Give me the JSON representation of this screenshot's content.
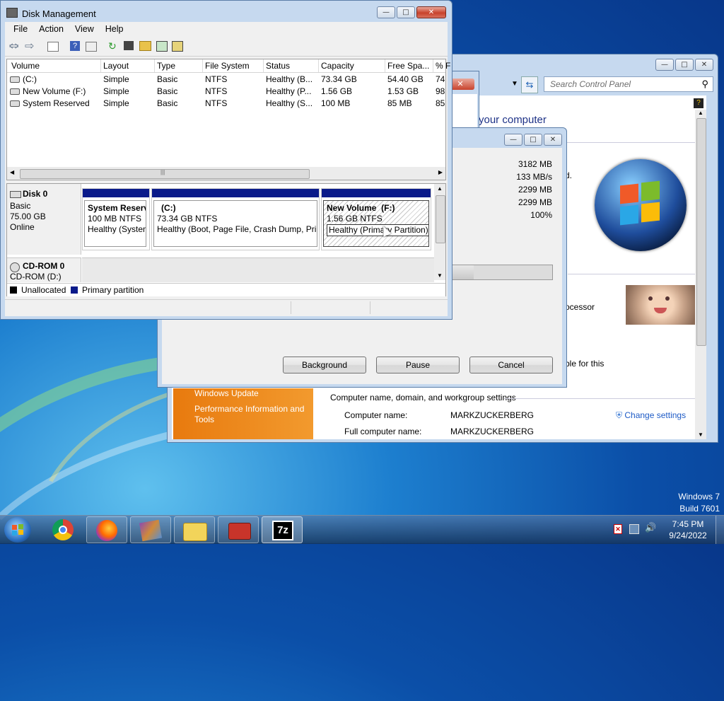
{
  "desktop": {
    "watermark": [
      "Windows 7",
      "Build 7601"
    ]
  },
  "control_panel": {
    "search_placeholder": "Search Control Panel",
    "heading_partial": "your computer",
    "processor_partial": "ocessor",
    "pen_partial": "d.",
    "able_partial": "ble for this",
    "side_links": [
      "Windows Update",
      "Performance Information and Tools"
    ],
    "section_title": "Computer name, domain, and workgroup settings",
    "computer_name_label": "Computer name:",
    "computer_name_value": "MARKZUCKERBERG",
    "full_name_label": "Full computer name:",
    "full_name_value": "MARKZUCKERBERG",
    "change_settings": "Change settings"
  },
  "progress_dialog": {
    "values": [
      "3182 MB",
      "133 MB/s",
      "2299 MB",
      "2299 MB",
      "100%"
    ],
    "progress_fraction": 0.35,
    "buttons": {
      "background": "Background",
      "pause": "Pause",
      "cancel": "Cancel"
    }
  },
  "disk_mgmt": {
    "title": "Disk Management",
    "menu": [
      "File",
      "Action",
      "View",
      "Help"
    ],
    "columns": [
      "Volume",
      "Layout",
      "Type",
      "File System",
      "Status",
      "Capacity",
      "Free Spa...",
      "% F"
    ],
    "rows": [
      [
        "(C:)",
        "Simple",
        "Basic",
        "NTFS",
        "Healthy (B...",
        "73.34 GB",
        "54.40 GB",
        "74"
      ],
      [
        "New Volume (F:)",
        "Simple",
        "Basic",
        "NTFS",
        "Healthy (P...",
        "1.56 GB",
        "1.53 GB",
        "98"
      ],
      [
        "System Reserved",
        "Simple",
        "Basic",
        "NTFS",
        "Healthy (S...",
        "100 MB",
        "85 MB",
        "85"
      ]
    ],
    "disk0": {
      "name": "Disk 0",
      "type": "Basic",
      "size": "75.00 GB",
      "status": "Online"
    },
    "partitions": [
      {
        "name": "System Reserv",
        "size": "100 MB NTFS",
        "status": "Healthy (Systen"
      },
      {
        "name": "(C:)",
        "size": "73.34 GB NTFS",
        "status": "Healthy (Boot, Page File, Crash Dump, Prin"
      },
      {
        "name": "New Volume  (F:)",
        "size": "1.56 GB NTFS",
        "status": "Healthy (Primary Partition)"
      }
    ],
    "cdrom": {
      "name": "CD-ROM 0",
      "drive": "CD-ROM (D:)"
    },
    "legend": {
      "unallocated": "Unallocated",
      "primary": "Primary partition"
    }
  },
  "taskbar": {
    "time": "7:45 PM",
    "date": "9/24/2022",
    "apps": [
      "chrome-icon",
      "firefox-icon",
      "winrar-icon",
      "folder-users-icon",
      "toolbox-icon",
      "7zip-icon"
    ],
    "sevenzip_label": "7z"
  }
}
